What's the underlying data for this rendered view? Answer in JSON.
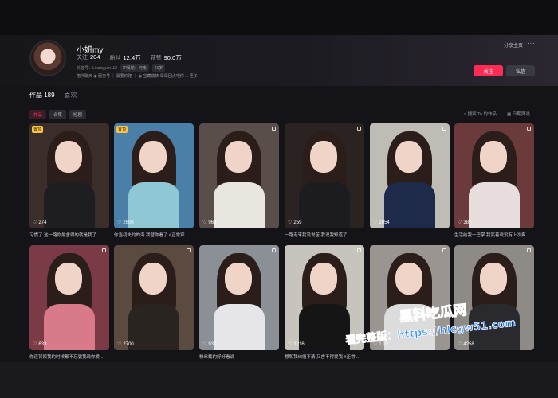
{
  "profile": {
    "name": "小妍my",
    "following_label": "关注",
    "following": "204",
    "followers_label": "粉丝",
    "followers": "12.4万",
    "likes_label": "获赞",
    "likes": "90.0万",
    "account_label": "抖音号：Linangyan112",
    "ip_label": "IP属地：河南",
    "age_tag": "21岁",
    "bio": "陪伴聊天 ◉ 服务号 ｜ 需要你陪 ｜ ◉ 宝藏装饰 早早回点喂你 ... 更多"
  },
  "actions": {
    "share": "分享主页",
    "follow": "关注",
    "message": "私信"
  },
  "tabs": [
    {
      "label": "作品 189"
    },
    {
      "label": "喜欢"
    }
  ],
  "chips": [
    {
      "label": "作品"
    },
    {
      "label": "合集"
    },
    {
      "label": "短剧"
    }
  ],
  "search_placeholder": "搜索 Ta 的作品",
  "sort_label": "日期筛选",
  "videos": [
    {
      "likes": "274",
      "caption": "习惯了 这一路你最舍得的就是我了",
      "badge": "置顶",
      "bg": "#3b2e2a",
      "outfit": "#1e1e22"
    },
    {
      "likes": "2606",
      "caption": "你当初失约的海 我替你看了 #正常穿...",
      "badge": "置顶",
      "bg": "#4a7fa8",
      "outfit": "#8fc7d4"
    },
    {
      "likes": "963",
      "caption": "",
      "badge": "",
      "bg": "#5a4e4a",
      "outfit": "#e9e6df"
    },
    {
      "likes": "259",
      "caption": "一路走来我没说苦 我说我知道了",
      "badge": "",
      "bg": "#2b2321",
      "outfit": "#1c1c20"
    },
    {
      "likes": "2054",
      "caption": "",
      "badge": "",
      "bg": "#bfbcb6",
      "outfit": "#1d2a4a"
    },
    {
      "likes": "387",
      "caption": "生活给我一巴掌 我笑着说没有上次爽",
      "badge": "",
      "bg": "#6b3b3b",
      "outfit": "#e8dede"
    },
    {
      "likes": "633",
      "caption": "你连背叛我的时候都不忘骗我说你爱...",
      "badge": "",
      "bg": "#7a3a46",
      "outfit": "#d97a8a"
    },
    {
      "likes": "2700",
      "caption": "",
      "badge": "",
      "bg": "#5b4a40",
      "outfit": "#2a2420"
    },
    {
      "likes": "930",
      "caption": "粉丝截的好好看说",
      "badge": "",
      "bg": "#8b8f96",
      "outfit": "#e6e6ea"
    },
    {
      "likes": "1216",
      "caption": "想和我纠缠不清 又舍不得爱我 #正常...",
      "badge": "",
      "bg": "#c7c3bd",
      "outfit": "#151515"
    },
    {
      "likes": "1,02",
      "caption": "",
      "badge": "",
      "bg": "#9a9590",
      "outfit": "#dcdcdc"
    },
    {
      "likes": "4258",
      "caption": "",
      "badge": "",
      "bg": "#8e8a86",
      "outfit": "#2a2a2e"
    }
  ],
  "watermark": {
    "main": "黑料吃瓜网",
    "url": "看完整版：https://hlcgw51.com"
  }
}
